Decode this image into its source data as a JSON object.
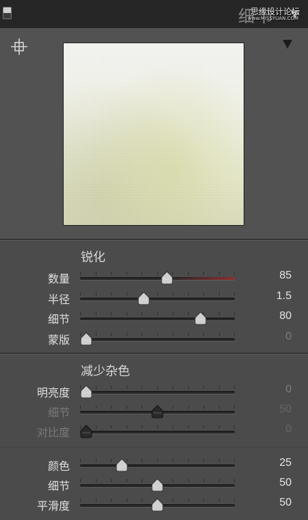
{
  "header": {
    "title": "细节",
    "watermark": "思缘设计论坛",
    "watermark_url": "www.MISSYUAN.COM"
  },
  "preview": {
    "target_icon": "crosshair-icon",
    "menu_icon": "triangle-down-icon"
  },
  "sharpening": {
    "title": "锐化",
    "rows": [
      {
        "label": "数量",
        "value": "85",
        "fraction": 0.56,
        "accent": true
      },
      {
        "label": "半径",
        "value": "1.5",
        "fraction": 0.41
      },
      {
        "label": "细节",
        "value": "80",
        "fraction": 0.78
      },
      {
        "label": "蒙版",
        "value": "0",
        "fraction": 0.04,
        "muted": true
      }
    ]
  },
  "noise_reduction": {
    "title": "减少杂色",
    "rows": [
      {
        "label": "明亮度",
        "value": "0",
        "fraction": 0.04,
        "muted": true
      },
      {
        "label": "细节",
        "value": "50",
        "fraction": 0.5,
        "dim": true
      },
      {
        "label": "对比度",
        "value": "0",
        "fraction": 0.04,
        "dim": true
      }
    ]
  },
  "color_nr": {
    "rows": [
      {
        "label": "颜色",
        "value": "25",
        "fraction": 0.27
      },
      {
        "label": "细节",
        "value": "50",
        "fraction": 0.5
      },
      {
        "label": "平滑度",
        "value": "50",
        "fraction": 0.5
      }
    ]
  },
  "colors": {
    "thumb_light": "#cfcfcf",
    "thumb_dark": "#2a2a2a",
    "accent": "#8c2f2f"
  }
}
